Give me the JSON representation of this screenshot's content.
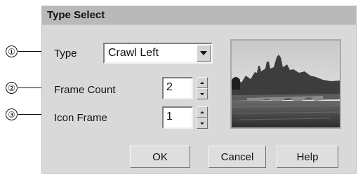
{
  "callouts": [
    "①",
    "②",
    "③"
  ],
  "dialog": {
    "title": "Type Select",
    "type_label": "Type",
    "type_value": "Crawl Left",
    "frame_count_label": "Frame Count",
    "frame_count_value": "2",
    "icon_frame_label": "Icon Frame",
    "icon_frame_value": "1",
    "buttons": {
      "ok": "OK",
      "cancel": "Cancel",
      "help": "Help"
    }
  },
  "icons": {
    "type_dropdown": "chevron-down-icon",
    "spin_up": "arrow-up-icon",
    "spin_down": "arrow-down-icon"
  }
}
